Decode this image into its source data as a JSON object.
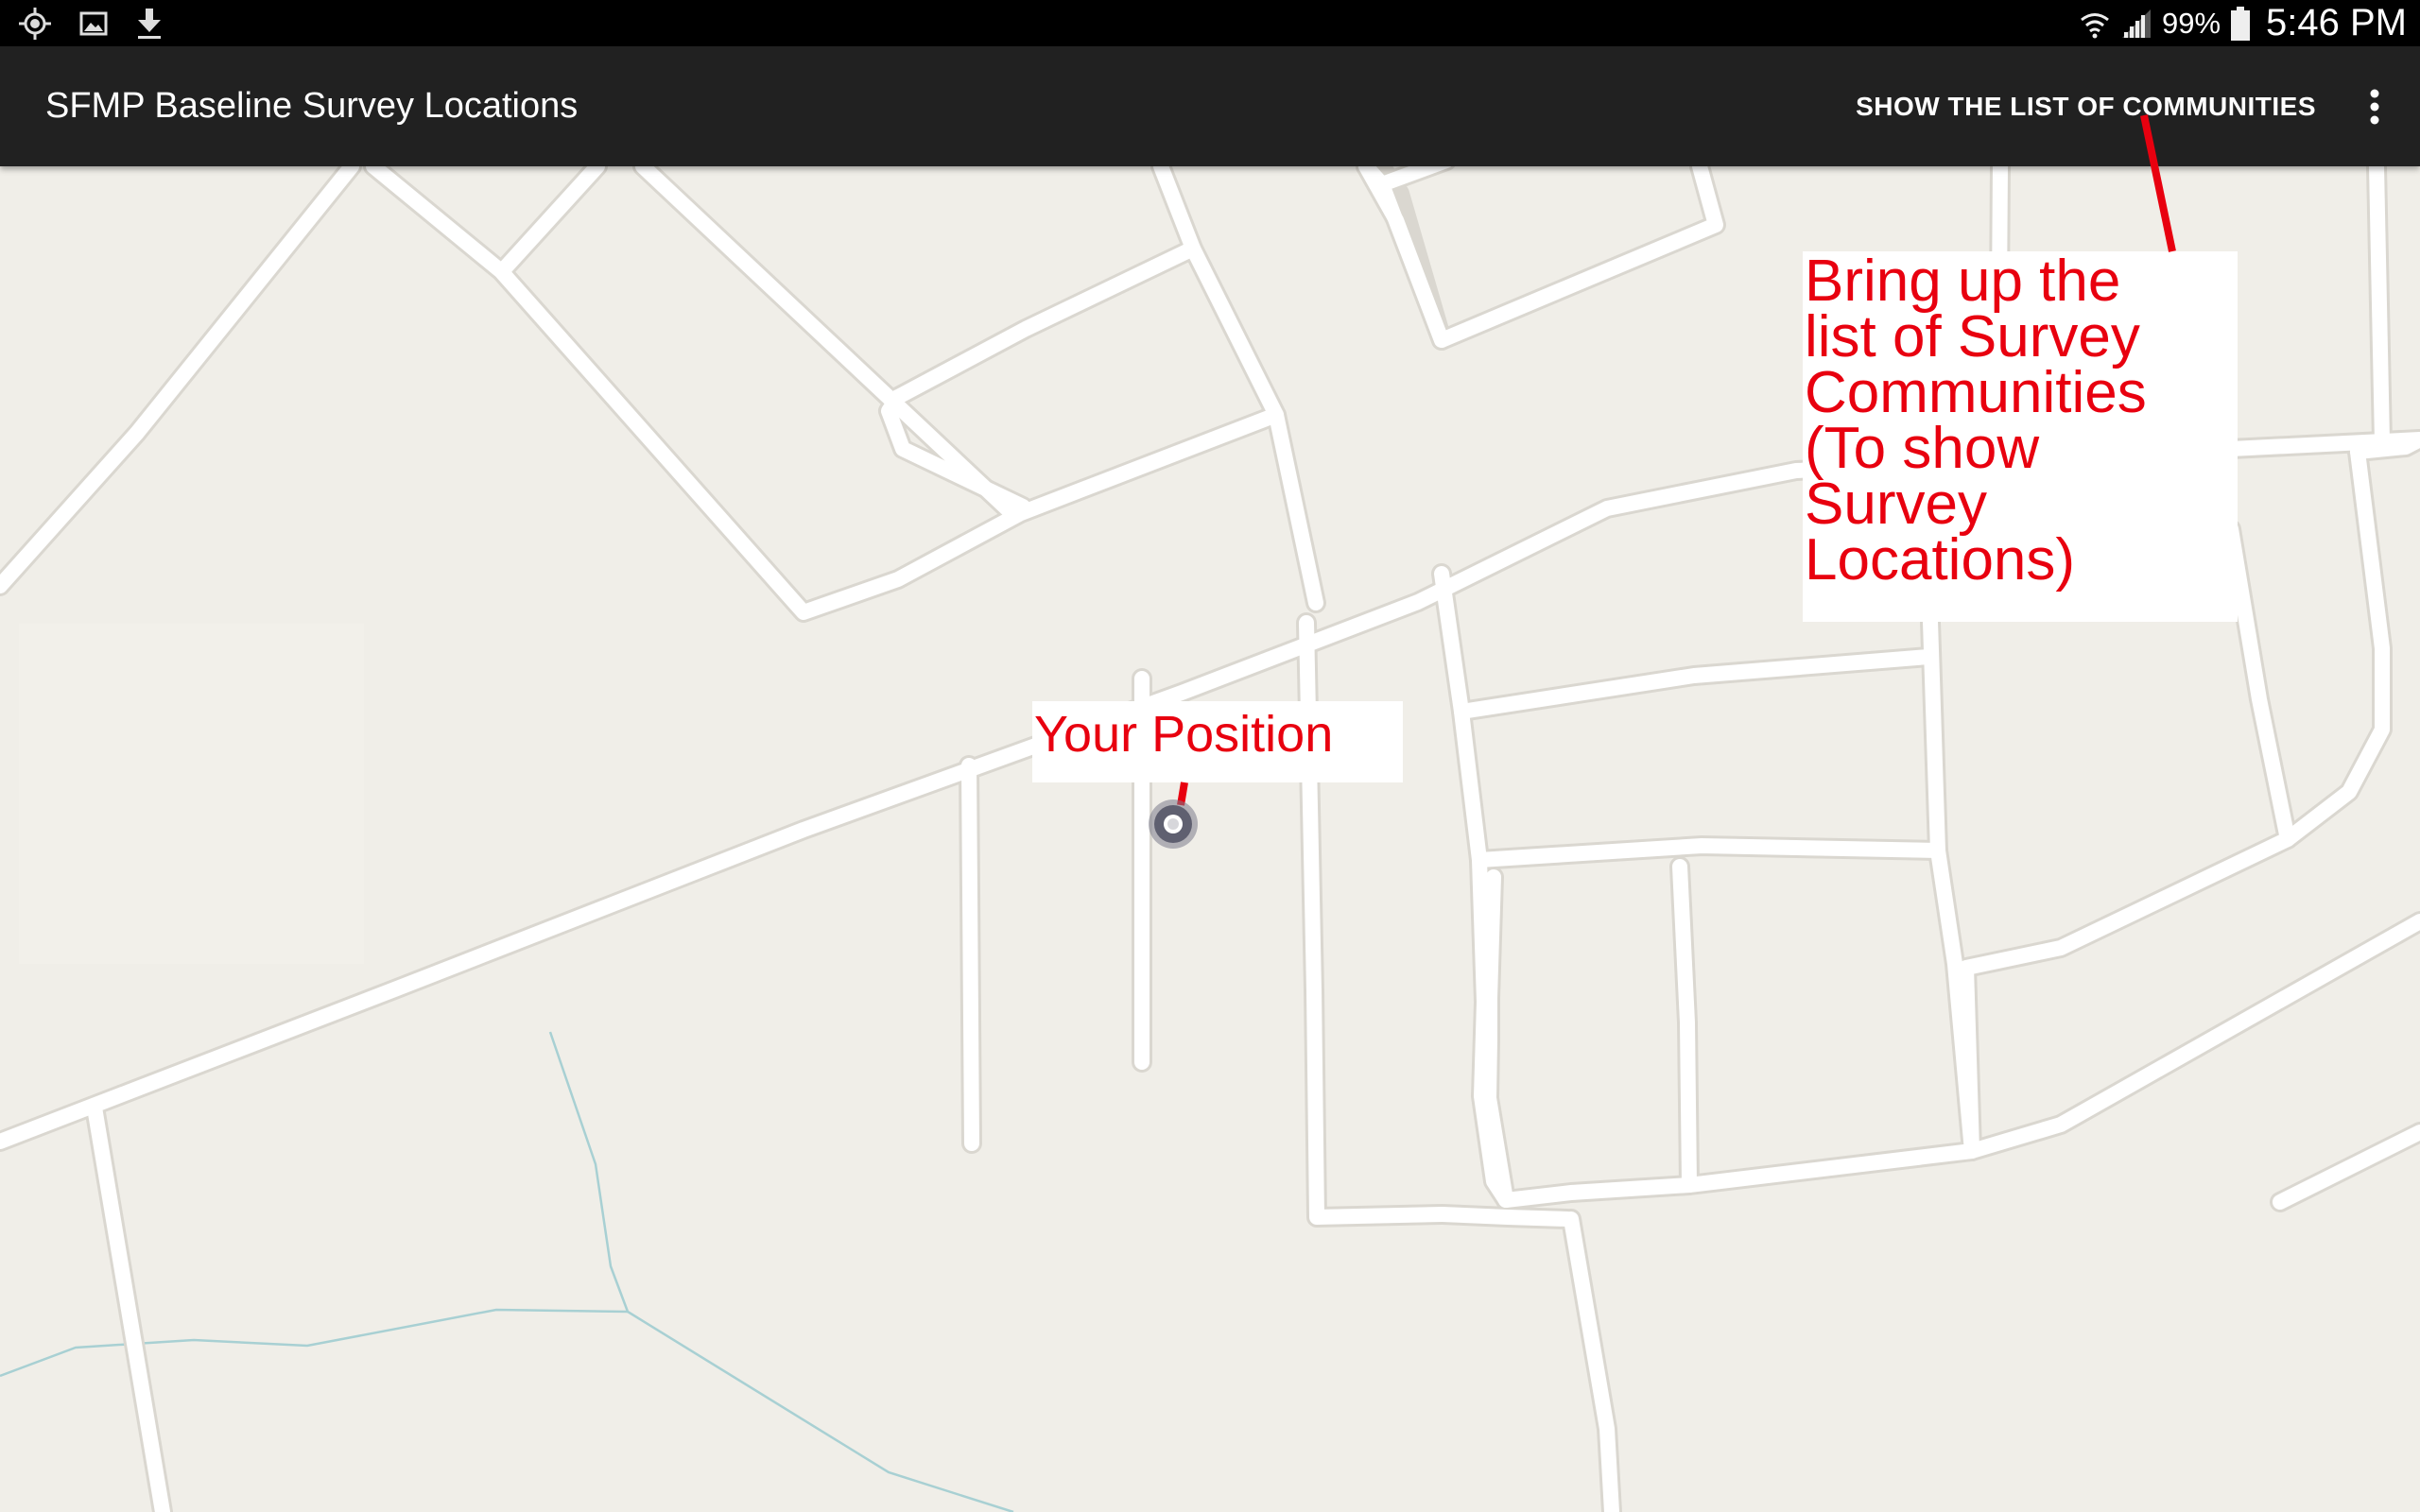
{
  "status_bar": {
    "left_icons": [
      "gps-icon",
      "image-icon",
      "download-icon"
    ],
    "right_icons": [
      "wifi-icon",
      "signal-icon",
      "battery-icon"
    ],
    "battery_percent": "99%",
    "time": "5:46 PM"
  },
  "action_bar": {
    "title": "SFMP Baseline Survey Locations",
    "show_list_label": "SHOW THE LIST OF COMMUNITIES",
    "overflow_icon": "more-vert-icon"
  },
  "map": {
    "background_color": "#f0eee8",
    "road_color": "#ffffff",
    "road_edge_color": "#dcd9d2",
    "water_color": "#a8d0d3",
    "marker_icon": "my-location-icon"
  },
  "annotations": {
    "position_label": "Your Position",
    "list_label": "Bring up the\nlist of Survey\nCommunities\n(To show\nSurvey\nLocations)",
    "color": "#e8000f"
  }
}
